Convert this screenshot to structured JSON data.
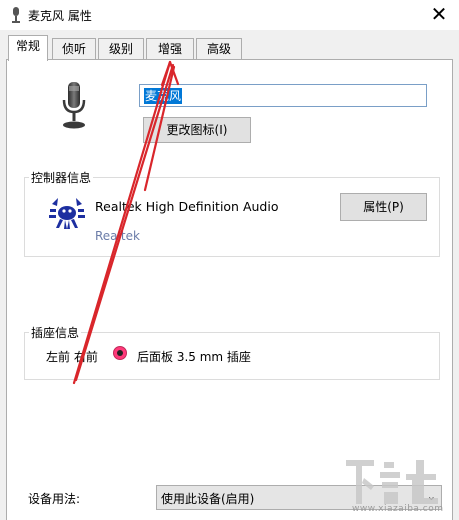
{
  "window": {
    "title": "麦克风 属性",
    "close_glyph": "✕"
  },
  "tabs": [
    {
      "label": "常规",
      "active": true
    },
    {
      "label": "侦听",
      "active": false
    },
    {
      "label": "级别",
      "active": false
    },
    {
      "label": "增强",
      "active": false
    },
    {
      "label": "高级",
      "active": false
    }
  ],
  "device": {
    "name": "麦克风",
    "change_icon_label": "更改图标(I)",
    "icon": "microphone-icon"
  },
  "controller": {
    "group_title": "控制器信息",
    "name": "Realtek High Definition Audio",
    "vendor": "Realtek",
    "properties_label": "属性(P)",
    "icon": "realtek-crab-logo"
  },
  "jack": {
    "group_title": "插座信息",
    "position": "左前 右前",
    "dot_color": "#ff3a7a",
    "description": "后面板 3.5 mm 插座"
  },
  "usage": {
    "label": "设备用法:",
    "selected": "使用此设备(启用)"
  },
  "annotation": {
    "arrow_color": "#d9262b",
    "icon": "red-arrow-annotation"
  },
  "watermark": {
    "text": "下载吧",
    "sub": "www.xiazaiba.com"
  }
}
